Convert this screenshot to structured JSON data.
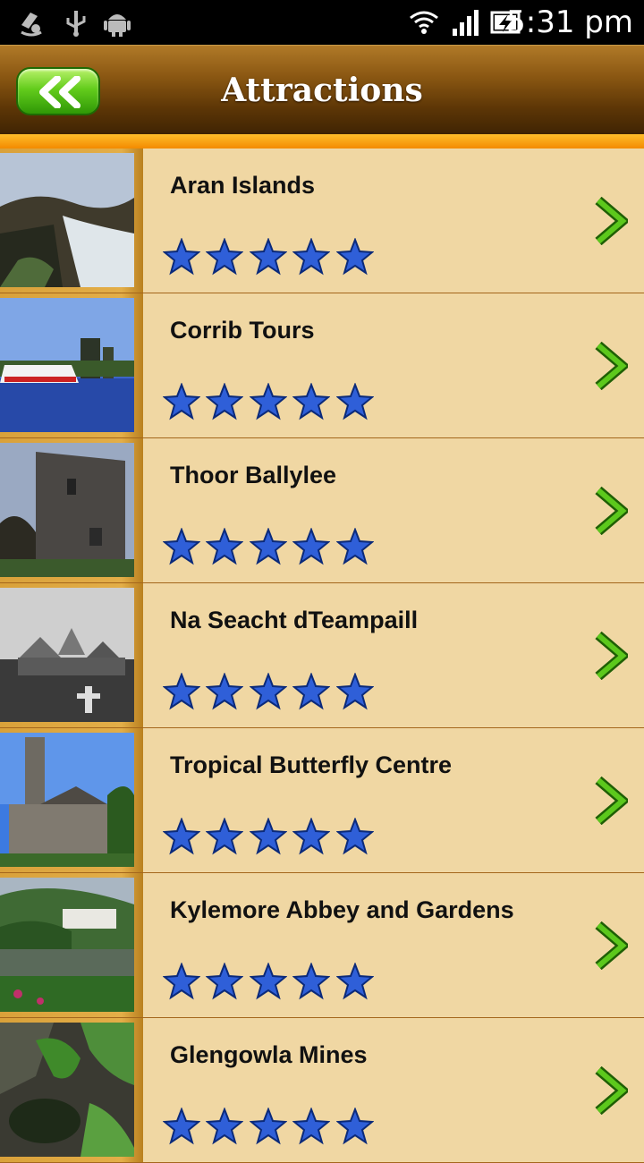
{
  "status_bar": {
    "time": "5:31 pm",
    "icons": [
      "location-icon",
      "usb-icon",
      "android-icon",
      "wifi-icon",
      "signal-icon",
      "battery-charging-icon"
    ]
  },
  "header": {
    "title": "Attractions",
    "back_icon": "double-chevron-left-icon"
  },
  "attractions": [
    {
      "name": "Aran Islands",
      "rating": 5
    },
    {
      "name": "Corrib Tours",
      "rating": 5
    },
    {
      "name": "Thoor Ballylee",
      "rating": 5
    },
    {
      "name": "Na Seacht dTeampaill",
      "rating": 5
    },
    {
      "name": "Tropical Butterfly Centre",
      "rating": 5
    },
    {
      "name": "Kylemore Abbey and Gardens",
      "rating": 5
    },
    {
      "name": "Glengowla Mines",
      "rating": 5
    }
  ],
  "colors": {
    "header_top": "#b07a28",
    "header_bottom": "#3e2303",
    "accent_orange": "#f38a00",
    "row_bg": "#f0d7a3",
    "star_blue": "#2f5fd8",
    "chevron_green": "#4cb814"
  }
}
